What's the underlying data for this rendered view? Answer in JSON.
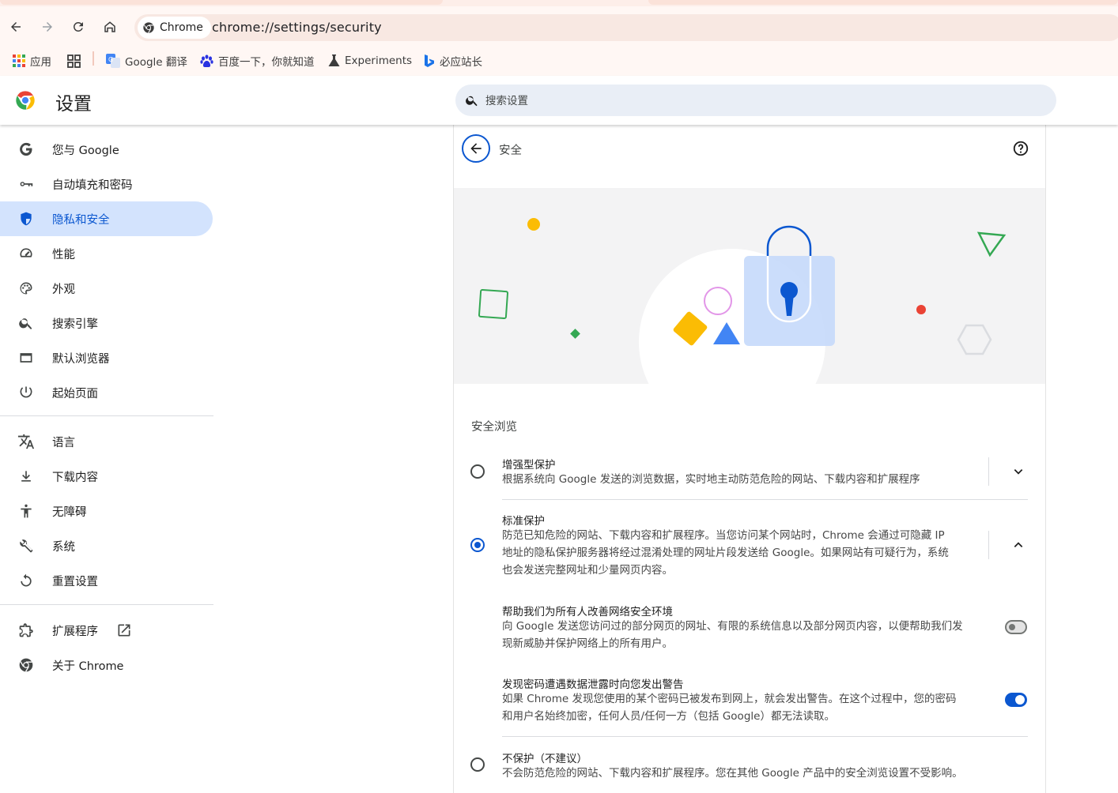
{
  "browser": {
    "site_chip_label": "Chrome",
    "url": "chrome://settings/security",
    "bookmarks": [
      {
        "label": "应用",
        "icon": "apps-grid-icon"
      },
      {
        "label": "",
        "icon": "grid-icon"
      },
      {
        "label": "Google 翻译",
        "icon": "google-translate-icon"
      },
      {
        "label": "百度一下，你就知道",
        "icon": "baidu-paw-icon"
      },
      {
        "label": "Experiments",
        "icon": "flask-icon"
      },
      {
        "label": "必应站长",
        "icon": "bing-icon"
      }
    ]
  },
  "header": {
    "title": "设置",
    "search_placeholder": "搜索设置"
  },
  "sidebar": {
    "items": [
      {
        "label": "您与 Google",
        "icon": "google-g-icon"
      },
      {
        "label": "自动填充和密码",
        "icon": "key-icon"
      },
      {
        "label": "隐私和安全",
        "icon": "shield-icon",
        "active": true
      },
      {
        "label": "性能",
        "icon": "speedometer-icon"
      },
      {
        "label": "外观",
        "icon": "palette-icon"
      },
      {
        "label": "搜索引擎",
        "icon": "search-icon"
      },
      {
        "label": "默认浏览器",
        "icon": "browser-window-icon"
      },
      {
        "label": "起始页面",
        "icon": "power-icon"
      },
      {
        "label": "语言",
        "icon": "translate-icon"
      },
      {
        "label": "下载内容",
        "icon": "download-icon"
      },
      {
        "label": "无障碍",
        "icon": "accessibility-icon"
      },
      {
        "label": "系统",
        "icon": "wrench-icon"
      },
      {
        "label": "重置设置",
        "icon": "reset-icon"
      },
      {
        "label": "扩展程序",
        "icon": "puzzle-icon"
      },
      {
        "label": "关于 Chrome",
        "icon": "chrome-logo-icon"
      }
    ]
  },
  "main": {
    "page_title": "安全",
    "section_title": "安全浏览",
    "options": [
      {
        "title": "增强型保护",
        "desc": "根据系统向 Google 发送的浏览数据，实时地主动防范危险的网站、下载内容和扩展程序",
        "selected": false,
        "expanded": false
      },
      {
        "title": "标准保护",
        "desc_lines": [
          "防范已知危险的网站、下载内容和扩展程序。当您访问某个网站时，Chrome 会通过可隐藏 IP",
          "地址的隐私保护服务器将经过混淆处理的网址片段发送给 Google。如果网站有可疑行为，系统",
          "也会发送完整网址和少量网页内容。"
        ],
        "selected": true,
        "expanded": true
      },
      {
        "title": "不保护（不建议）",
        "desc": "不会防范危险的网站、下载内容和扩展程序。您在其他 Google 产品中的安全浏览设置不受影响。",
        "selected": false
      }
    ],
    "toggles": [
      {
        "title": "帮助我们为所有人改善网络安全环境",
        "desc_lines": [
          "向 Google 发送您访问过的部分网页的网址、有限的系统信息以及部分网页内容，以便帮助我们发",
          "现新威胁并保护网络上的所有用户。"
        ],
        "on": false
      },
      {
        "title": "发现密码遭遇数据泄露时向您发出警告",
        "desc_lines": [
          "如果 Chrome 发现您使用的某个密码已被发布到网上，就会发出警告。在这个过程中，您的密码",
          "和用户名始终加密，任何人员/任何一方（包括 Google）都无法读取。"
        ],
        "on": true
      }
    ]
  },
  "colors": {
    "accent": "#0b57d0",
    "active_nav_bg": "#d3e3fd",
    "search_bg": "#e9eef6",
    "toolbar_bg": "#fff7f4"
  }
}
